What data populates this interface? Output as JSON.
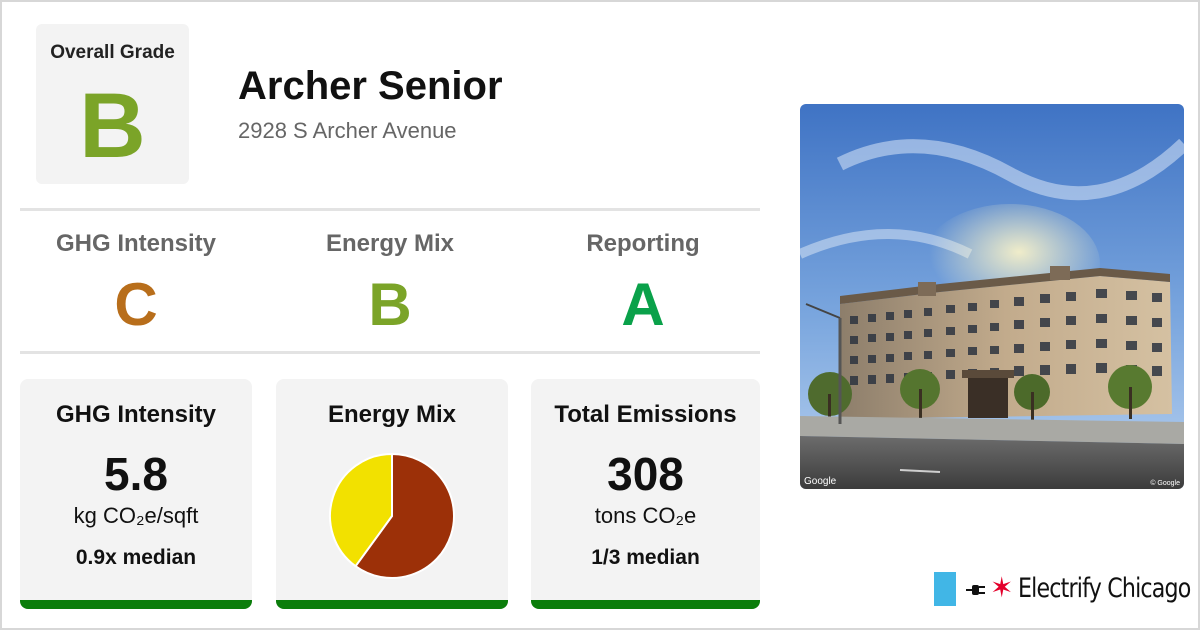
{
  "overall": {
    "label": "Overall Grade",
    "grade": "B",
    "grade_color": "#7ba428"
  },
  "building": {
    "name": "Archer Senior",
    "address": "2928 S Archer Avenue"
  },
  "grades": [
    {
      "label": "GHG Intensity",
      "grade": "C",
      "color": "#b86e1b"
    },
    {
      "label": "Energy Mix",
      "grade": "B",
      "color": "#7ba428"
    },
    {
      "label": "Reporting",
      "grade": "A",
      "color": "#0aa14a"
    }
  ],
  "cards": {
    "ghg": {
      "title": "GHG Intensity",
      "value": "5.8",
      "unit": "kg CO₂e/sqft",
      "compare": "0.9x median",
      "bar_color": "#0b7d0b"
    },
    "mix": {
      "title": "Energy Mix",
      "bar_color": "#0b7d0b"
    },
    "emissions": {
      "title": "Total Emissions",
      "value": "308",
      "unit": "tons CO₂e",
      "compare": "1/3 median",
      "bar_color": "#0b7d0b"
    }
  },
  "chart_data": {
    "type": "pie",
    "slices": [
      {
        "value": 0.6,
        "color": "#9c3008"
      },
      {
        "value": 0.4,
        "color": "#f2e100"
      }
    ]
  },
  "photo": {
    "credit_left": "Google",
    "credit_right": "© Google"
  },
  "logo": {
    "text": "Electrify Chicago",
    "flag_color": "#41b6e6",
    "star_color": "#e4002b"
  }
}
